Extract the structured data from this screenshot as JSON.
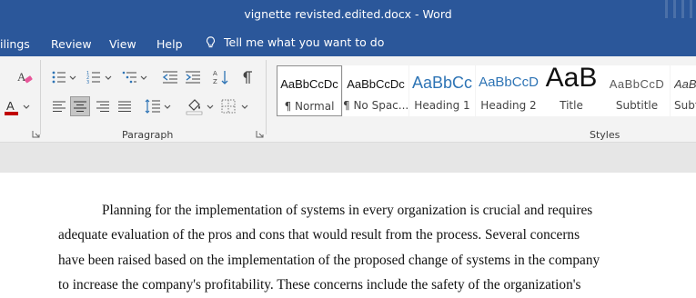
{
  "window": {
    "title": "vignette revisted.edited.docx  -  Word"
  },
  "tabs": [
    "ilings",
    "Review",
    "View",
    "Help"
  ],
  "tell_me": {
    "placeholder": "Tell me what you want to do",
    "icon": "lightbulb-icon"
  },
  "ribbon": {
    "paragraph_group_label": "Paragraph",
    "styles_group_label": "Styles",
    "styles": [
      {
        "preview": "AaBbCcDc",
        "name": "¶ Normal",
        "selected": true
      },
      {
        "preview": "AaBbCcDc",
        "name": "¶ No Spac..."
      },
      {
        "preview": "AaBbCc",
        "name": "Heading 1"
      },
      {
        "preview": "AaBbCcD",
        "name": "Heading 2"
      },
      {
        "preview": "AaB",
        "name": "Title"
      },
      {
        "preview": "AaBbCcD",
        "name": "Subtitle"
      },
      {
        "preview": "AaBl",
        "name": "Subtl"
      }
    ]
  },
  "document": {
    "lines": [
      "Planning for the implementation of systems in every organization is crucial and requires",
      "adequate evaluation of the pros and cons that would result from the process. Several concerns",
      "have been raised based on the implementation of the proposed change of systems in the company",
      "to increase the company's profitability. These concerns include the safety of the organization's"
    ]
  },
  "colors": {
    "title_bar": "#2b579a",
    "ribbon_bg": "#f3f3f3",
    "font_color_red": "#c00000",
    "heading_blue": "#2e74b5"
  }
}
